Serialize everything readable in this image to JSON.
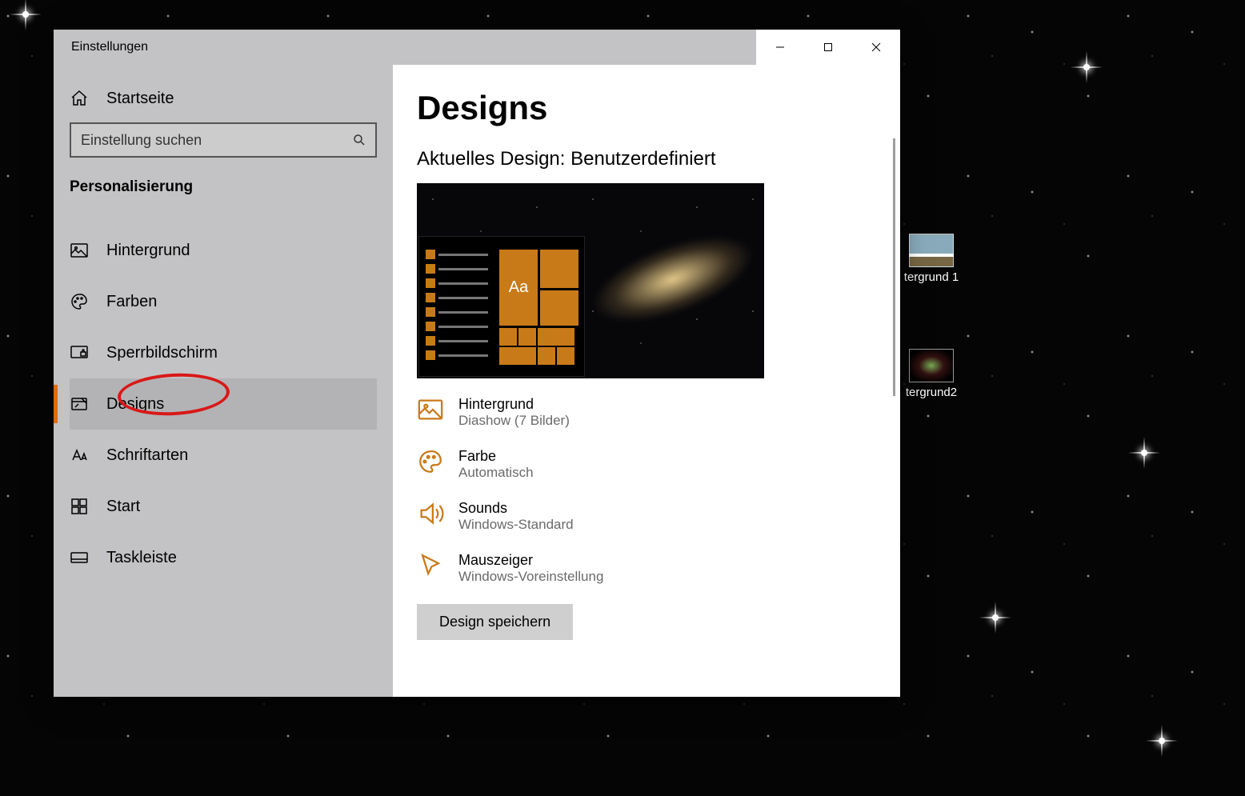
{
  "window": {
    "title": "Einstellungen"
  },
  "sidebar": {
    "home_label": "Startseite",
    "search_placeholder": "Einstellung suchen",
    "section_heading": "Personalisierung",
    "items": [
      {
        "label": "Hintergrund"
      },
      {
        "label": "Farben"
      },
      {
        "label": "Sperrbildschirm"
      },
      {
        "label": "Designs"
      },
      {
        "label": "Schriftarten"
      },
      {
        "label": "Start"
      },
      {
        "label": "Taskleiste"
      }
    ],
    "selected_index": 3
  },
  "page": {
    "title": "Designs",
    "subtitle_prefix": "Aktuelles Design:",
    "subtitle_value": "Benutzerdefiniert",
    "preview_aa": "Aa",
    "settings": [
      {
        "label": "Hintergrund",
        "value": "Diashow (7 Bilder)"
      },
      {
        "label": "Farbe",
        "value": "Automatisch"
      },
      {
        "label": "Sounds",
        "value": "Windows-Standard"
      },
      {
        "label": "Mauszeiger",
        "value": "Windows-Voreinstellung"
      }
    ],
    "save_button": "Design speichern"
  },
  "desktop_icons": [
    {
      "label": "tergrund 1"
    },
    {
      "label": "tergrund2"
    }
  ],
  "accent_color": "#c97a18"
}
